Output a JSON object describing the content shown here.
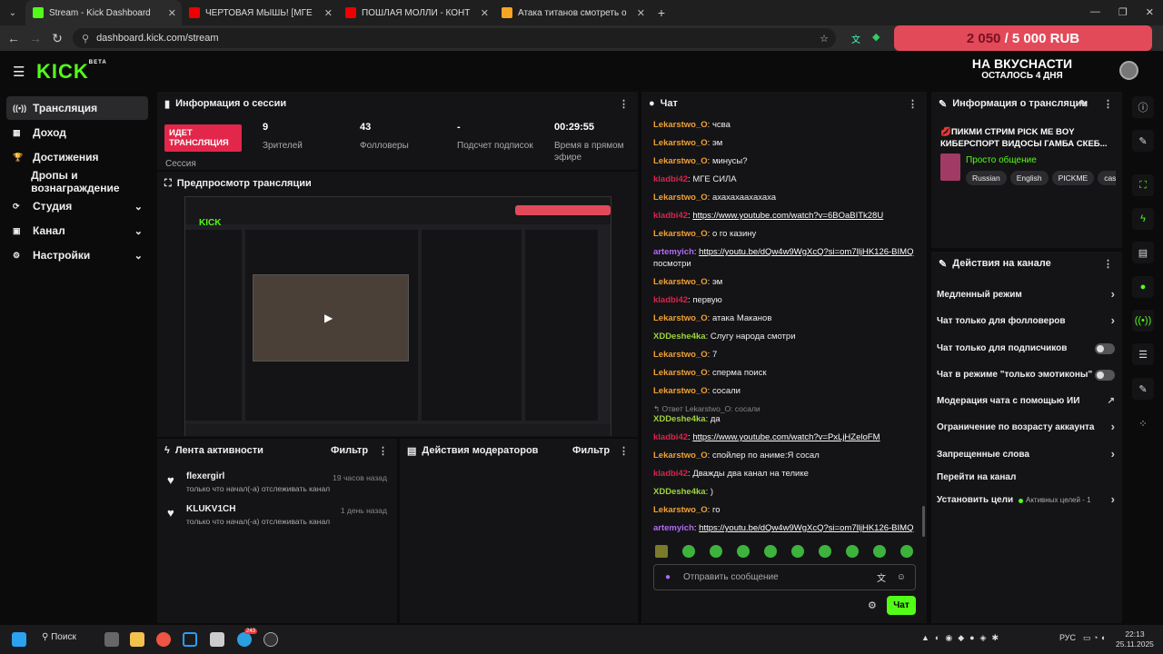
{
  "browser": {
    "tabs": [
      {
        "title": "Stream - Kick Dashboard",
        "color": "#53fc18"
      },
      {
        "title": "ЧЕРТОВАЯ МЫШЬ! [МГЕ страш",
        "color": "#e00"
      },
      {
        "title": "ПОШЛАЯ МОЛЛИ - КОНТРАК",
        "color": "#e00"
      },
      {
        "title": "Атака титанов смотреть онлай",
        "color": "#f5a623"
      }
    ],
    "url": "dashboard.kick.com/stream"
  },
  "donation": {
    "current": "2 050",
    "separator": "/",
    "goal": "5 000 RUB"
  },
  "header": {
    "logo": "KICK",
    "logo_badge": "BETA",
    "goal_title": "НА ВКУСНАСТИ",
    "goal_sub": "ОСТАЛОСЬ 4 ДНЯ"
  },
  "sidebar": {
    "items": [
      {
        "label": "Трансляция",
        "icon": "((•))"
      },
      {
        "label": "Доход",
        "icon": "▦"
      },
      {
        "label": "Достижения",
        "icon": "🏆"
      },
      {
        "label": "Дропы и вознаграждение",
        "icon": ""
      },
      {
        "label": "Студия",
        "icon": "⟳"
      },
      {
        "label": "Канал",
        "icon": "▣"
      },
      {
        "label": "Настройки",
        "icon": "⚙"
      }
    ]
  },
  "session": {
    "title": "Информация о сессии",
    "live_badge": "ИДЕТ ТРАНСЛЯЦИЯ",
    "session_label": "Сессия",
    "stats": [
      {
        "value": "9",
        "label": "Зрителей"
      },
      {
        "value": "43",
        "label": "Фолловеры"
      },
      {
        "value": "-",
        "label": "Подсчет подписок"
      },
      {
        "value": "00:29:55",
        "label": "Время в прямом эфире"
      }
    ]
  },
  "preview": {
    "title": "Предпросмотр трансляции"
  },
  "activity": {
    "title": "Лента активности",
    "filter": "Фильтр",
    "items": [
      {
        "user": "flexergirl",
        "time": "19 часов назад",
        "text": "только что начал(-а) отслеживать канал"
      },
      {
        "user": "KLUKV1CH",
        "time": "1 день назад",
        "text": "только что начал(-а) отслеживать канал"
      }
    ]
  },
  "modactions": {
    "title": "Действия модераторов",
    "filter": "Фильтр"
  },
  "chat": {
    "title": "Чат",
    "messages": [
      {
        "user": "Lekarstwo_O",
        "cls": "u1",
        "text": "чсва"
      },
      {
        "user": "Lekarstwo_O",
        "cls": "u1",
        "text": "эм"
      },
      {
        "user": "Lekarstwo_O",
        "cls": "u1",
        "text": "минусы?"
      },
      {
        "user": "kladbi42",
        "cls": "u2",
        "text": "МГЕ СИЛА"
      },
      {
        "user": "Lekarstwo_O",
        "cls": "u1",
        "text": "ахахахаахахаха"
      },
      {
        "user": "kladbi42",
        "cls": "u2",
        "text": "https://www.youtube.com/watch?v=6BOaBITk28U",
        "link": true
      },
      {
        "user": "Lekarstwo_O",
        "cls": "u1",
        "text": "о го казину"
      },
      {
        "user": "artemyich",
        "cls": "u3",
        "text": "https://youtu.be/dQw4w9WgXcQ?si=om7lljHK126-BIMQ",
        "link": true,
        "extra": "посмотри"
      },
      {
        "user": "Lekarstwo_O",
        "cls": "u1",
        "text": "эм"
      },
      {
        "user": "kladbi42",
        "cls": "u2",
        "text": "первую"
      },
      {
        "user": "Lekarstwo_O",
        "cls": "u1",
        "text": "атака Маканов"
      },
      {
        "user": "XDDeshe4ka",
        "cls": "u4",
        "text": "Слугу народа смотри"
      },
      {
        "user": "Lekarstwo_O",
        "cls": "u1",
        "text": "7"
      },
      {
        "user": "Lekarstwo_O",
        "cls": "u1",
        "text": "сперма поиск"
      },
      {
        "user": "Lekarstwo_O",
        "cls": "u1",
        "text": "сосали"
      },
      {
        "user": "XDDeshe4ka",
        "cls": "u4",
        "text": "да",
        "reply": "↰ Ответ Lekarstwo_O: сосали"
      },
      {
        "user": "kladbi42",
        "cls": "u2",
        "text": "https://www.youtube.com/watch?v=PxLjHZeloFM",
        "link": true
      },
      {
        "user": "Lekarstwo_O",
        "cls": "u1",
        "text": "спойлер по аниме:Я сосал"
      },
      {
        "user": "kladbi42",
        "cls": "u2",
        "text": "Дважды два канал на телике"
      },
      {
        "user": "XDDeshe4ka",
        "cls": "u4",
        "text": ")"
      },
      {
        "user": "Lekarstwo_O",
        "cls": "u1",
        "text": "го"
      },
      {
        "user": "artemyich",
        "cls": "u3",
        "text": "https://youtu.be/dQw4w9WgXcQ?si=om7lljHK126-BIMQ",
        "link": true
      }
    ],
    "placeholder": "Отправить сообщение",
    "send": "Чат"
  },
  "stream_info": {
    "title": "Информация о трансляции",
    "stream_title": "💋ПИКМИ СТРИМ PICK ME BOY КИБЕРСПОРТ ВИДОСЫ ГАМБА СКЕБ...",
    "category": "Просто общение",
    "tags": [
      "Russian",
      "English",
      "PICKME",
      "casin"
    ]
  },
  "channel_actions": {
    "title": "Действия на канале",
    "items": [
      {
        "label": "Медленный режим",
        "type": "arrow"
      },
      {
        "label": "Чат только для фолловеров",
        "type": "arrow"
      },
      {
        "label": "Чат только для подписчиков",
        "type": "toggle"
      },
      {
        "label": "Чат в режиме \"только эмотиконы\"",
        "type": "toggle"
      },
      {
        "label": "Модерация чата с помощью ИИ",
        "type": "ext"
      },
      {
        "label": "Ограничение по возрасту аккаунта",
        "type": "arrow"
      },
      {
        "label": "Запрещенные слова",
        "type": "arrow"
      },
      {
        "label": "Перейти на канал",
        "type": "none"
      },
      {
        "label": "Установить цели",
        "type": "arrow",
        "badge": "Активных целей - 1"
      }
    ]
  },
  "taskbar": {
    "search": "Поиск",
    "lang": "РУС",
    "time": "22:13",
    "date": "25.11.2025",
    "badge": "243"
  }
}
